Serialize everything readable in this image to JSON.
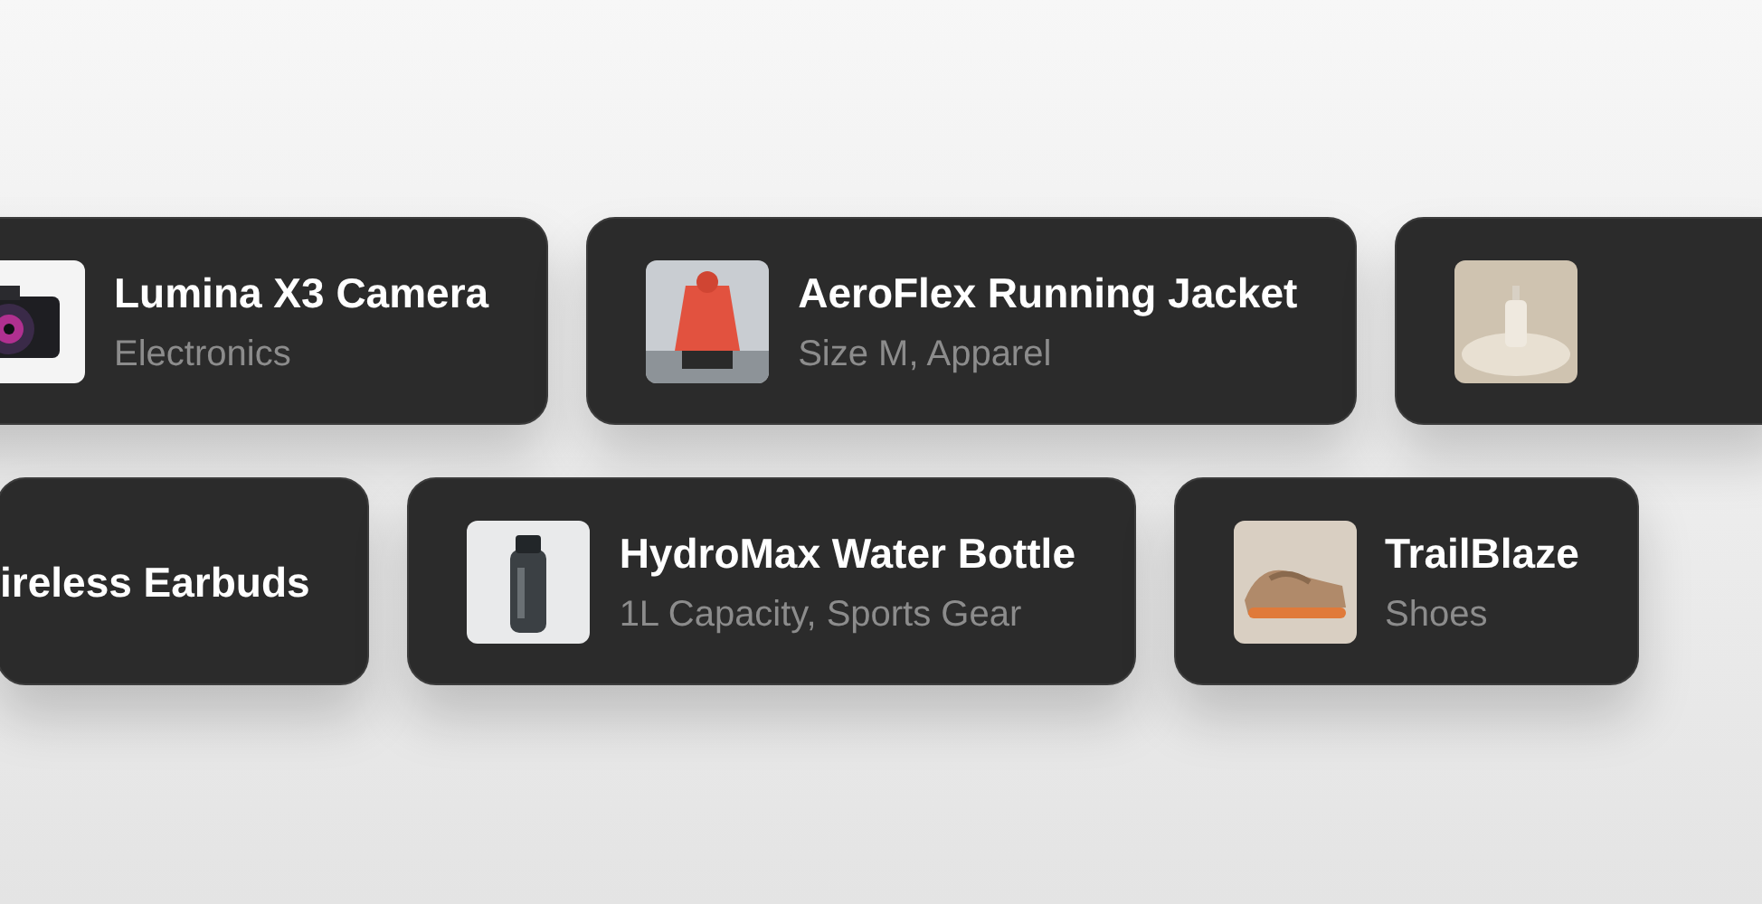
{
  "rows": [
    {
      "items": [
        {
          "title": "Lumina X3 Camera",
          "subtitle": "Electronics",
          "image": {
            "kind": "picture"
          }
        },
        {
          "title": "AeroFlex Running Jacket",
          "subtitle": "Size M, Apparel",
          "image": {
            "kind": "picture"
          }
        },
        {
          "image": {
            "kind": "picture"
          }
        }
      ]
    },
    {
      "items": [
        {
          "title": "ireless Earbuds"
        },
        {
          "title": "HydroMax Water Bottle",
          "subtitle": "1L Capacity, Sports Gear",
          "image": {
            "kind": "picture"
          }
        },
        {
          "title": "TrailBlaze",
          "subtitle": "Shoes",
          "image": {
            "kind": "picture"
          }
        }
      ]
    }
  ]
}
